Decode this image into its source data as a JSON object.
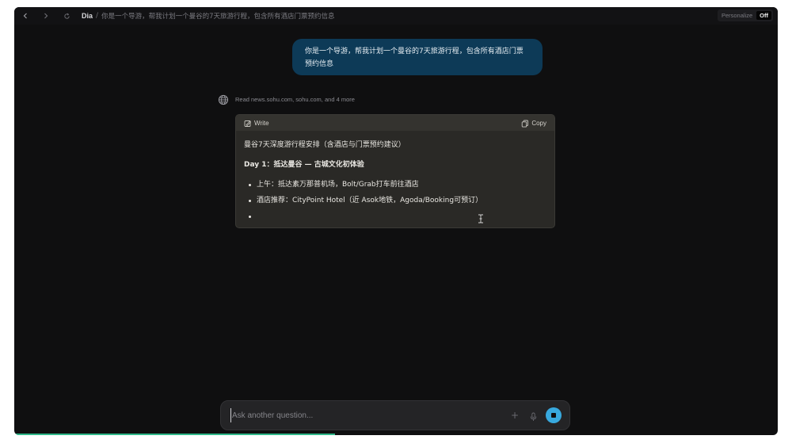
{
  "topbar": {
    "app_name": "Dia",
    "separator": "/",
    "page_title": "你是一个导游，帮我计划一个曼谷的7天旅游行程，包含所有酒店门票预约信息",
    "personalize_label": "Personalize",
    "personalize_state": "Off"
  },
  "user_message": "你是一个导游，帮我计划一个曼谷的7天旅游行程，包含所有酒店门票预约信息",
  "sources": {
    "text": "Read news.sohu.com, sohu.com, and 4 more",
    "icon": "globe-icon"
  },
  "write_card": {
    "header_label": "Write",
    "copy_label": "Copy",
    "title": "曼谷7天深度游行程安排（含酒店与门票预约建议）",
    "day_heading": "Day 1：抵达曼谷 — 古城文化初体验",
    "bullets": [
      "上午：抵达素万那普机场，Bolt/Grab打车前往酒店",
      "酒店推荐：CityPoint Hotel（近 Asok地铁，Agoda/Booking可预订）",
      ""
    ]
  },
  "ask_bar": {
    "placeholder": "Ask another question..."
  },
  "progress": {
    "fraction": 0.42
  },
  "colors": {
    "background": "#0f0f10",
    "user_bubble": "#0d3a57",
    "card": "#2a2926",
    "accent": "#38a9de",
    "progress": "#2fb88a"
  }
}
